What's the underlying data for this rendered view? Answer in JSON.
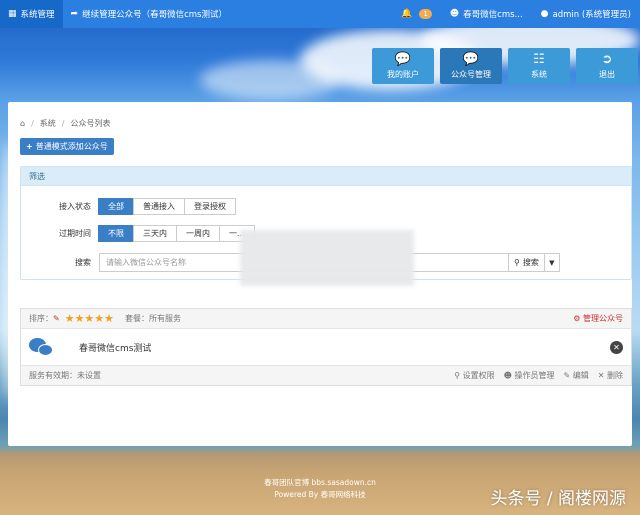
{
  "topbar": {
    "system_mgmt": "系统管理",
    "continue_mgmt": "继续管理公众号（春哥微信cms测试）",
    "notif_count": "1",
    "account_name": "春哥微信cms...",
    "user": "admin (系统管理员)"
  },
  "tiles": [
    {
      "label": "我的账户",
      "icon": "chat-icon"
    },
    {
      "label": "公众号管理",
      "icon": "chat-icon"
    },
    {
      "label": "系统",
      "icon": "sitemap-icon"
    },
    {
      "label": "退出",
      "icon": "logout-icon"
    }
  ],
  "breadcrumb": {
    "items": [
      "系统",
      "公众号列表"
    ]
  },
  "add_button": "普通模式添加公众号",
  "filter": {
    "title": "筛选",
    "access_label": "接入状态",
    "access_options": [
      "全部",
      "普通接入",
      "登录授权"
    ],
    "access_selected": "全部",
    "expire_label": "过期时间",
    "expire_options": [
      "不限",
      "三天内",
      "一周内",
      "一..."
    ],
    "expire_selected": "不限",
    "search_label": "搜索",
    "search_placeholder": "请输入微信公众号名称",
    "search_button": "搜索"
  },
  "card": {
    "sort_label": "排序：",
    "package_label": "套餐：所有服务",
    "manage_label": "管理公众号",
    "account_name": "春哥微信cms测试",
    "service_validity": "服务有效期：未设置",
    "actions": [
      "设置权限",
      "操作员管理",
      "编辑",
      "删除"
    ]
  },
  "footer": {
    "line1": "春哥团队官博 bbs.sasadown.cn",
    "line2": "Powered By 春哥网络科技"
  },
  "watermark": "头条号 / 阁楼网源",
  "colors": {
    "topbar": "#2a7fe0",
    "primary": "#3a7fc6",
    "filter_head": "#d9ecf8",
    "danger": "#c9302c",
    "star": "#f0a020"
  }
}
